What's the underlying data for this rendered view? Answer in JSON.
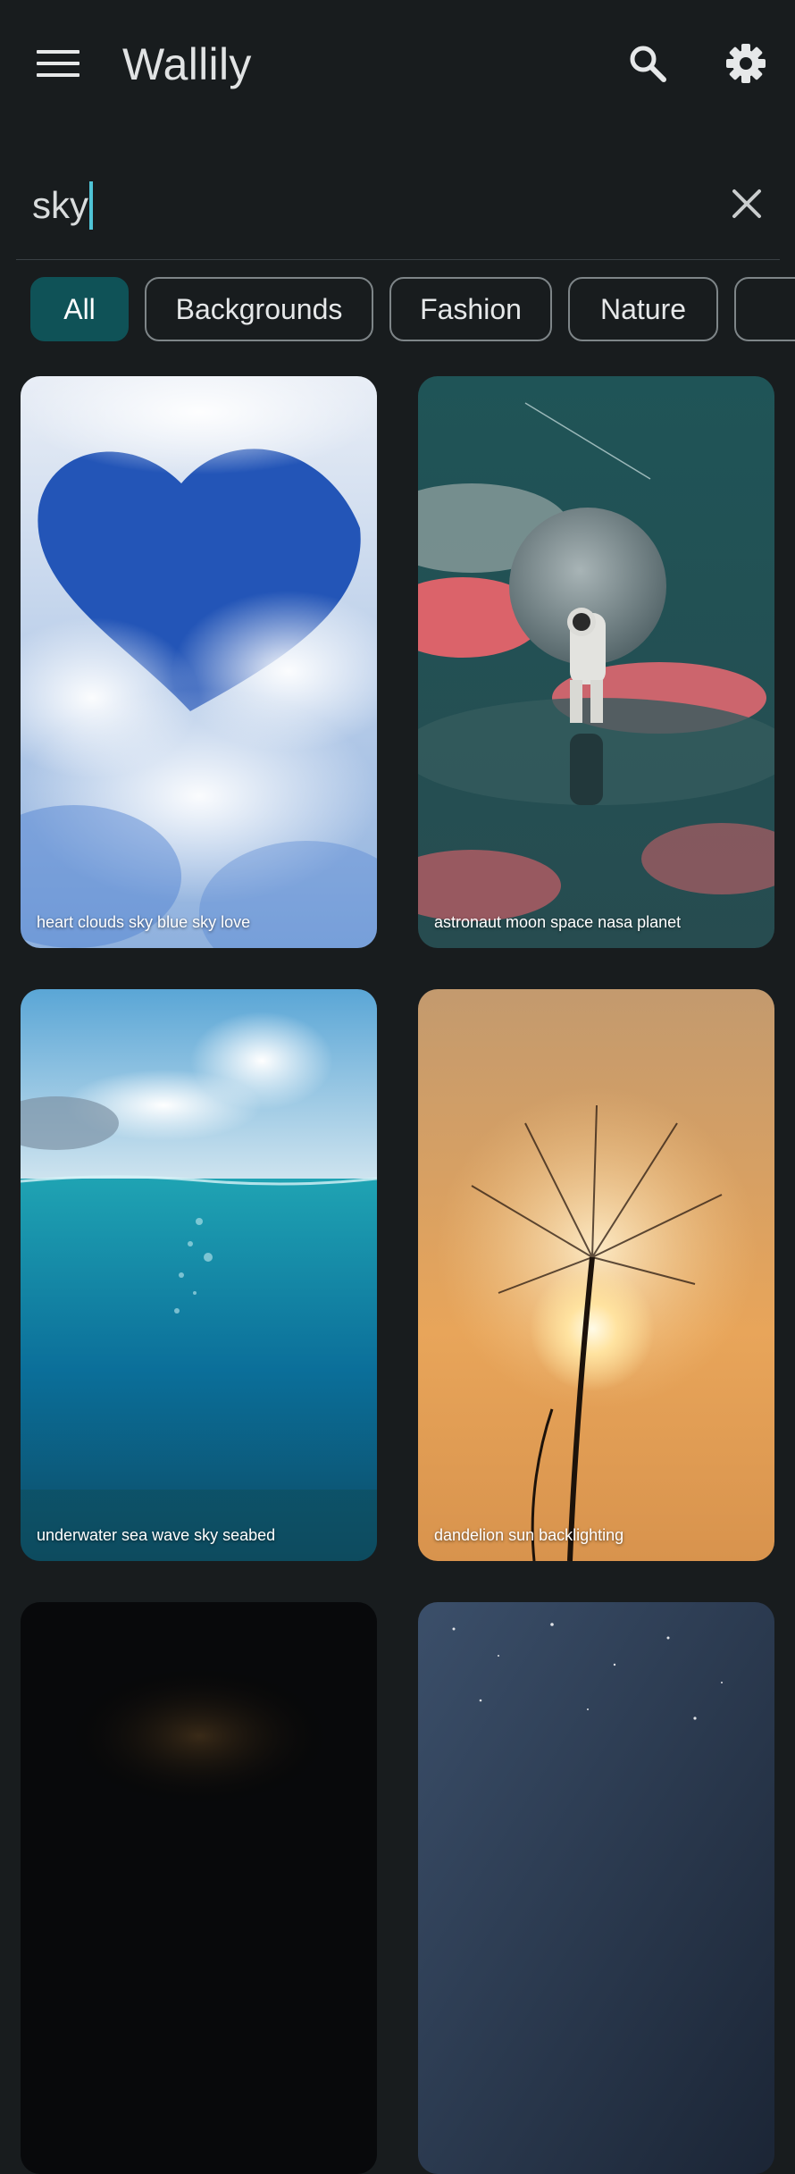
{
  "app": {
    "title": "Wallily"
  },
  "search": {
    "query": "sky"
  },
  "categories": [
    {
      "label": "All",
      "active": true
    },
    {
      "label": "Backgrounds",
      "active": false
    },
    {
      "label": "Fashion",
      "active": false
    },
    {
      "label": "Nature",
      "active": false
    },
    {
      "label": "",
      "active": false
    }
  ],
  "wallpapers": [
    {
      "tags": "heart clouds sky blue sky love",
      "icon": "heart-cloud-image"
    },
    {
      "tags": "astronaut moon space nasa planet",
      "icon": "astronaut-moon-image"
    },
    {
      "tags": "underwater sea wave sky seabed",
      "icon": "underwater-sea-image"
    },
    {
      "tags": "dandelion sun backlighting",
      "icon": "dandelion-sun-image"
    },
    {
      "tags": "",
      "icon": "dark-night-image"
    },
    {
      "tags": "",
      "icon": "milky-way-image"
    }
  ],
  "colors": {
    "background": "#181c1e",
    "accent": "#0f5257",
    "caret": "#4fc3d6"
  }
}
